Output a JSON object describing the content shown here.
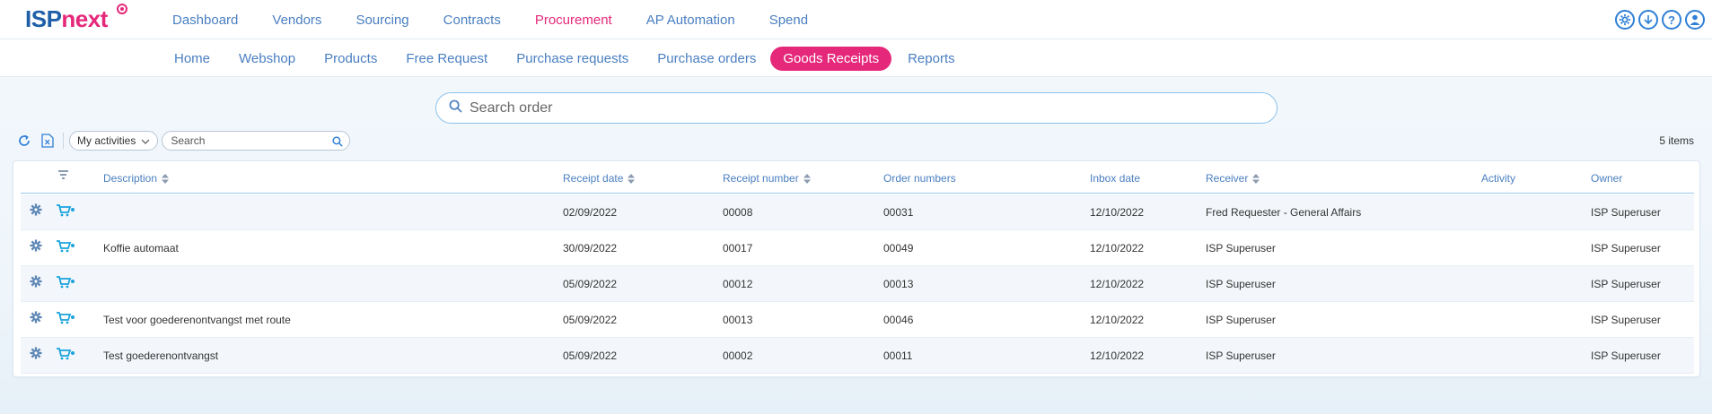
{
  "brand": {
    "left": "ISP",
    "right": "next"
  },
  "main_nav": [
    {
      "label": "Dashboard",
      "active": false
    },
    {
      "label": "Vendors",
      "active": false
    },
    {
      "label": "Sourcing",
      "active": false
    },
    {
      "label": "Contracts",
      "active": false
    },
    {
      "label": "Procurement",
      "active": true
    },
    {
      "label": "AP Automation",
      "active": false
    },
    {
      "label": "Spend",
      "active": false
    }
  ],
  "top_icons": [
    "gear-icon",
    "download-icon",
    "help-icon",
    "user-icon"
  ],
  "sub_nav": [
    {
      "label": "Home",
      "active": false
    },
    {
      "label": "Webshop",
      "active": false
    },
    {
      "label": "Products",
      "active": false
    },
    {
      "label": "Free Request",
      "active": false
    },
    {
      "label": "Purchase requests",
      "active": false
    },
    {
      "label": "Purchase orders",
      "active": false
    },
    {
      "label": "Goods Receipts",
      "active": true
    },
    {
      "label": "Reports",
      "active": false
    }
  ],
  "order_search": {
    "placeholder": "Search order"
  },
  "toolbar": {
    "filter_value": "My activities",
    "search_placeholder": "Search",
    "item_count": "5 items"
  },
  "table": {
    "columns": {
      "description": "Description",
      "receipt_date": "Receipt date",
      "receipt_number": "Receipt number",
      "order_numbers": "Order numbers",
      "inbox_date": "Inbox date",
      "receiver": "Receiver",
      "activity": "Activity",
      "owner": "Owner"
    },
    "rows": [
      {
        "description": "",
        "receipt_date": "02/09/2022",
        "receipt_number": "00008",
        "order_numbers": "00031",
        "inbox_date": "12/10/2022",
        "receiver": "Fred Requester - General Affairs",
        "activity": "",
        "owner": "ISP Superuser"
      },
      {
        "description": "Koffie automaat",
        "receipt_date": "30/09/2022",
        "receipt_number": "00017",
        "order_numbers": "00049",
        "inbox_date": "12/10/2022",
        "receiver": "ISP Superuser",
        "activity": "",
        "owner": "ISP Superuser"
      },
      {
        "description": "",
        "receipt_date": "05/09/2022",
        "receipt_number": "00012",
        "order_numbers": "00013",
        "inbox_date": "12/10/2022",
        "receiver": "ISP Superuser",
        "activity": "",
        "owner": "ISP Superuser"
      },
      {
        "description": "Test voor goederenontvangst met route",
        "receipt_date": "05/09/2022",
        "receipt_number": "00013",
        "order_numbers": "00046",
        "inbox_date": "12/10/2022",
        "receiver": "ISP Superuser",
        "activity": "",
        "owner": "ISP Superuser"
      },
      {
        "description": "Test goederenontvangst",
        "receipt_date": "05/09/2022",
        "receipt_number": "00002",
        "order_numbers": "00011",
        "inbox_date": "12/10/2022",
        "receiver": "ISP Superuser",
        "activity": "",
        "owner": "ISP Superuser"
      }
    ]
  },
  "colors": {
    "accent": "#e5287a",
    "link": "#4a7fc1",
    "icon": "#2f7fd6"
  }
}
